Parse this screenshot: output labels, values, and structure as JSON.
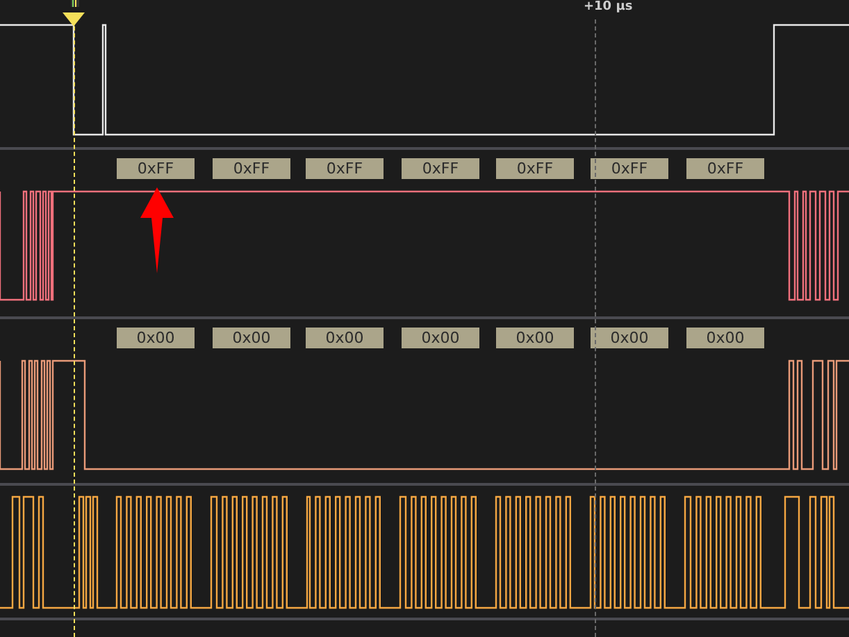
{
  "time_label": "+10 µs",
  "channels": [
    {
      "color": "#e8e8e8"
    },
    {
      "color": "#f0707c",
      "decode": [
        "0xFF",
        "0xFF",
        "0xFF",
        "0xFF",
        "0xFF",
        "0xFF",
        "0xFF"
      ]
    },
    {
      "color": "#e89a78",
      "decode": [
        "0x00",
        "0x00",
        "0x00",
        "0x00",
        "0x00",
        "0x00",
        "0x00"
      ]
    },
    {
      "color": "#f5a742"
    }
  ]
}
